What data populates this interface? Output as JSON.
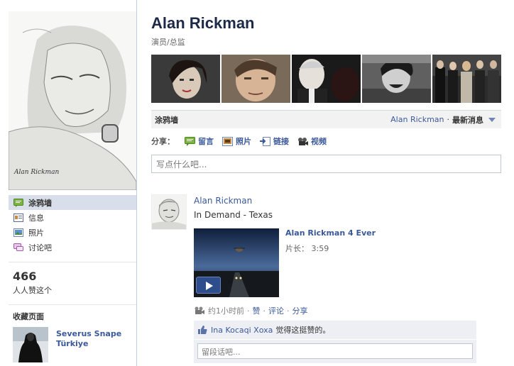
{
  "profile": {
    "name": "Alan Rickman",
    "subtitle": "演员/总监",
    "signature": "Alan Rickman"
  },
  "left_nav": {
    "items": [
      {
        "label": "涂鸦墙",
        "icon": "wall-icon",
        "active": true
      },
      {
        "label": "信息",
        "icon": "info-icon",
        "active": false
      },
      {
        "label": "照片",
        "icon": "photos-icon",
        "active": false
      },
      {
        "label": "讨论吧",
        "icon": "discussion-icon",
        "active": false
      }
    ]
  },
  "likes": {
    "count": "466",
    "label": "人人赞这个"
  },
  "favorites": {
    "title": "收藏页面",
    "page_name": "Severus Snape Türkiye"
  },
  "wall_bar": {
    "title": "涂鸦墙",
    "filter_name": "Alan Rickman",
    "filter_dot": "·",
    "filter_selected": "最新消息"
  },
  "share": {
    "label": "分享：",
    "items": [
      {
        "label": "留言",
        "icon": "status-icon"
      },
      {
        "label": "照片",
        "icon": "photo-icon"
      },
      {
        "label": "链接",
        "icon": "link-icon"
      },
      {
        "label": "视频",
        "icon": "video-icon"
      }
    ]
  },
  "composer": {
    "placeholder": "写点什么吧..."
  },
  "post": {
    "author": "Alan Rickman",
    "text": "In Demand - Texas",
    "video_title": "Alan Rickman 4 Ever",
    "video_length": "片长： 3:59",
    "time": "约1小时前",
    "dot": "·",
    "like_action": "赞",
    "comment_action": "评论",
    "share_action": "分享",
    "liked_by": "Ina Kocaqi Xoxa",
    "liked_text": "觉得这挺赞的。",
    "comment_placeholder": "留段话吧..."
  },
  "colors": {
    "link": "#3b5998",
    "name": "#1c2a47",
    "nav_active": "#d8dfea",
    "bar_bg": "#f2f2f2"
  }
}
